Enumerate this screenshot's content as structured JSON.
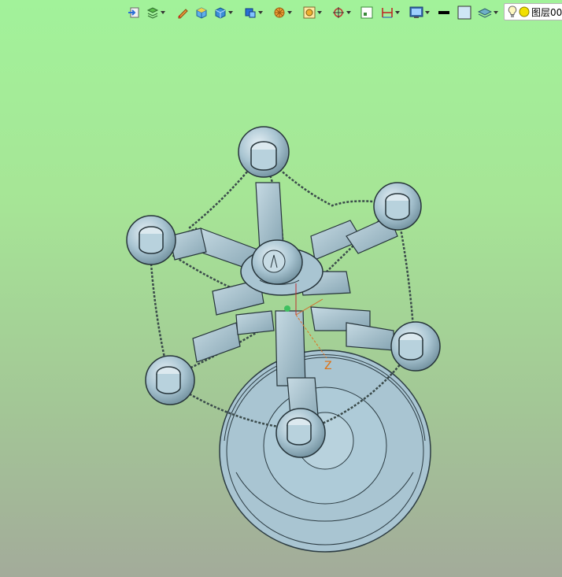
{
  "toolbar": {
    "icons": [
      {
        "name": "import-icon"
      },
      {
        "name": "layers-icon",
        "dropdown": true
      },
      {
        "name": "pencil-icon"
      },
      {
        "name": "solid-box-icon"
      },
      {
        "name": "shaded-cube-icon",
        "dropdown": true
      },
      {
        "name": "view-cube-icon",
        "dropdown": true
      },
      {
        "name": "sphere-pattern-icon",
        "dropdown": true
      },
      {
        "name": "render-frame-icon",
        "dropdown": true
      },
      {
        "name": "snap-target-icon",
        "dropdown": true
      },
      {
        "name": "fit-view-icon"
      },
      {
        "name": "dimension-icon",
        "dropdown": true
      },
      {
        "name": "display-settings-icon",
        "dropdown": true
      },
      {
        "name": "line-color-swatch-icon"
      },
      {
        "name": "fill-color-swatch-icon"
      },
      {
        "name": "layer-stack-icon",
        "dropdown": true
      }
    ],
    "layer_selector": {
      "label": "图层00",
      "bulb_icon": "lightbulb-icon",
      "status_color": "#f2e000"
    }
  },
  "viewport": {
    "axis_label": "Z",
    "background_top": "#a2f29a",
    "background_bottom": "#a3ab9a",
    "model_color": "#a9c5d2",
    "chain_color": "#3a4a4a"
  }
}
